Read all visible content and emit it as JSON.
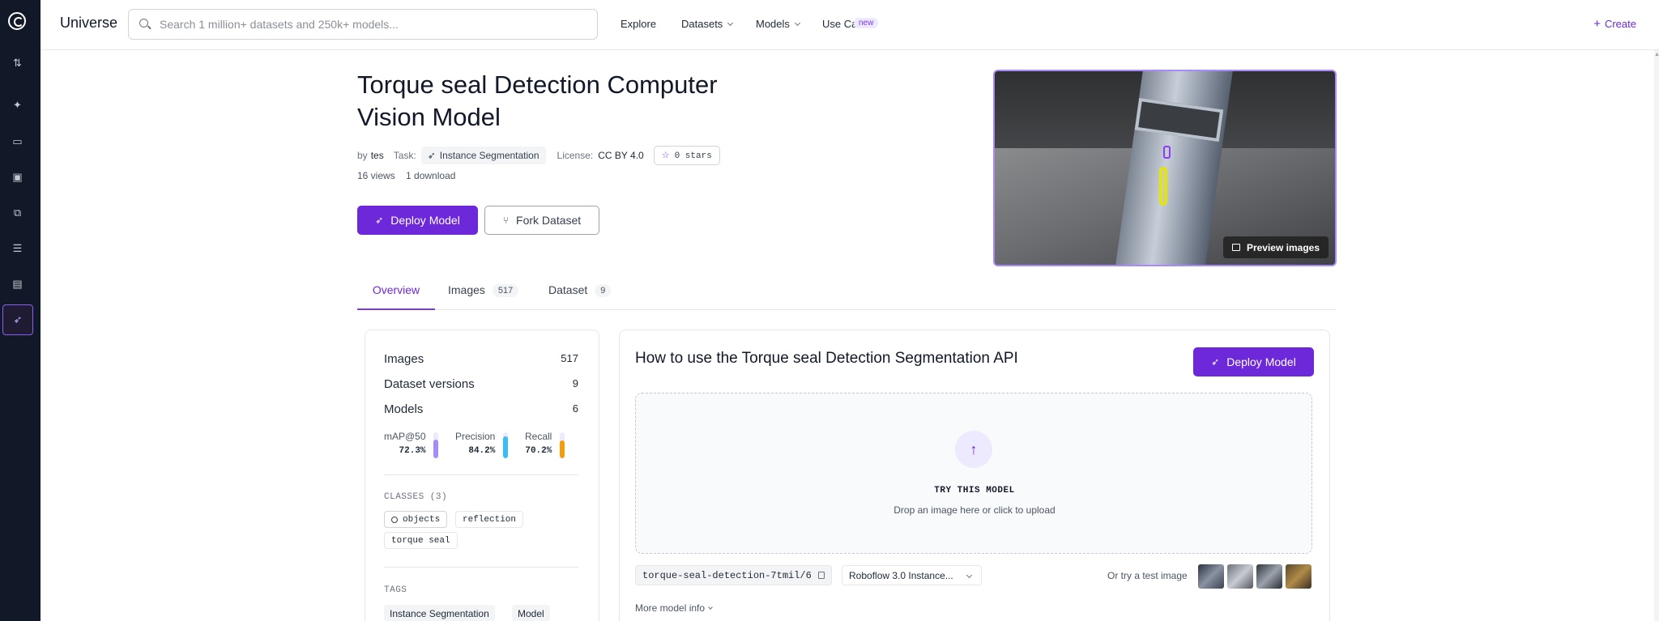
{
  "app": {
    "brand": "Universe",
    "search": {
      "placeholder": "Search 1 million+ datasets and 250k+ models..."
    },
    "nav": {
      "explore": "Explore",
      "datasets": "Datasets",
      "models": "Models",
      "use_cases": "Use Cases",
      "use_cases_badge": "new",
      "create": "Create"
    },
    "rail_icons": [
      "logo-icon",
      "swap-icon",
      "sparkle-icon",
      "inbox-icon",
      "image-icon",
      "workflow-icon",
      "server-icon",
      "analytics-icon",
      "deploy-icon"
    ]
  },
  "header": {
    "title_line1": "Torque seal Detection Computer",
    "title_line2": "Vision Model",
    "by_label": "by",
    "author": "tes",
    "task_label": "Task:",
    "task": "Instance Segmentation",
    "license_label": "License:",
    "license": "CC BY 4.0",
    "stars": "0 stars",
    "views": "16 views",
    "downloads": "1 download",
    "deploy_button": "Deploy Model",
    "fork_button": "Fork Dataset",
    "preview_button": "Preview images"
  },
  "tabs": [
    {
      "label": "Overview",
      "count": ""
    },
    {
      "label": "Images",
      "count": "517"
    },
    {
      "label": "Dataset",
      "count": "9"
    }
  ],
  "summary": {
    "images_label": "Images",
    "images": "517",
    "versions_label": "Dataset versions",
    "versions": "9",
    "models_label": "Models",
    "models": "6",
    "metrics": [
      {
        "name": "mAP@50",
        "value": "72.3%",
        "fraction": 0.723,
        "color": "#a78bfa"
      },
      {
        "name": "Precision",
        "value": "84.2%",
        "fraction": 0.842,
        "color": "#38bdf8"
      },
      {
        "name": "Recall",
        "value": "70.2%",
        "fraction": 0.702,
        "color": "#f59e0b"
      }
    ],
    "classes_label": "CLASSES (3)",
    "classes": [
      "objects",
      "reflection",
      "torque seal"
    ],
    "tags_label": "TAGS",
    "tags": [
      "Instance Segmentation",
      "Model"
    ]
  },
  "api": {
    "title": "How to use the Torque seal Detection Segmentation API",
    "deploy_button": "Deploy Model",
    "try_title": "TRY THIS MODEL",
    "drop_text": "Drop an image here or click to upload",
    "model_id": "torque-seal-detection-7tmil/6",
    "model_version": "Roboflow 3.0 Instance...",
    "test_image_label": "Or try a test image",
    "more_info": "More model info"
  },
  "colors": {
    "accent": "#6d28d9",
    "rail": "#111827"
  }
}
